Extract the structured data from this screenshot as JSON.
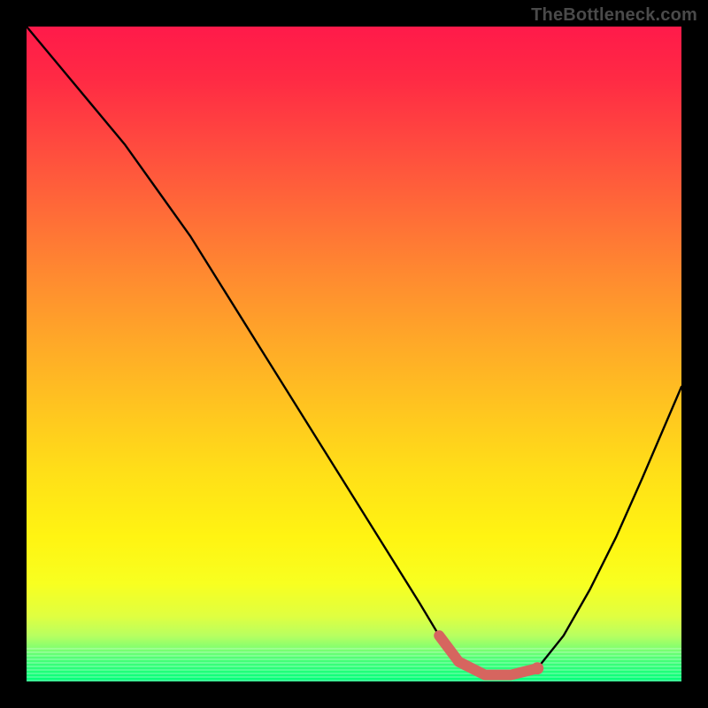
{
  "watermark": "TheBottleneck.com",
  "colors": {
    "frame": "#000000",
    "watermark": "#4a4a4a",
    "curve": "#000000",
    "marker": "#d6655f",
    "gradient_top": "#ff1a4a",
    "gradient_bottom": "#00ff7a"
  },
  "chart_data": {
    "type": "line",
    "title": "",
    "xlabel": "",
    "ylabel": "",
    "xlim": [
      0,
      100
    ],
    "ylim": [
      0,
      100
    ],
    "grid": false,
    "legend": false,
    "series": [
      {
        "name": "bottleneck-curve",
        "x": [
          0,
          5,
          10,
          15,
          20,
          25,
          30,
          35,
          40,
          45,
          50,
          55,
          60,
          63,
          66,
          70,
          74,
          78,
          82,
          86,
          90,
          94,
          100
        ],
        "y": [
          100,
          94,
          88,
          82,
          75,
          68,
          60,
          52,
          44,
          36,
          28,
          20,
          12,
          7,
          3,
          1,
          1,
          2,
          7,
          14,
          22,
          31,
          45
        ]
      },
      {
        "name": "optimal-region",
        "x": [
          63,
          66,
          70,
          74,
          78
        ],
        "y": [
          7,
          3,
          1,
          1,
          2
        ]
      }
    ],
    "annotations": []
  }
}
